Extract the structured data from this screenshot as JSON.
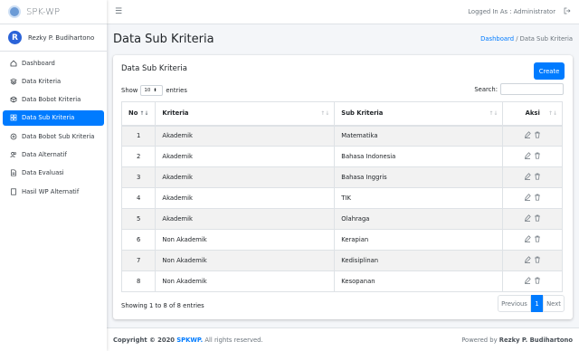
{
  "app": {
    "brand": "SPK-WP",
    "user_initial": "R",
    "user_name": "Rezky P. Budihartono"
  },
  "sidebar": {
    "items": [
      {
        "label": "Dashboard",
        "icon": "home-icon"
      },
      {
        "label": "Data Kriteria",
        "icon": "layers-icon"
      },
      {
        "label": "Data Bobot Kriteria",
        "icon": "cube-icon"
      },
      {
        "label": "Data Sub Kriteria",
        "icon": "grid-icon"
      },
      {
        "label": "Data Bobot Sub Kriteria",
        "icon": "circle-plus-icon"
      },
      {
        "label": "Data Alternatif",
        "icon": "users-icon"
      },
      {
        "label": "Data Evaluasi",
        "icon": "file-icon"
      },
      {
        "label": "Hasil WP Alternatif",
        "icon": "document-icon"
      }
    ],
    "active_index": 3
  },
  "navbar": {
    "logged_in": "Logged In As : Administrator"
  },
  "header": {
    "title": "Data Sub Kriteria",
    "crumb_link": "Dashboard",
    "crumb_sep": "/",
    "crumb_current": "Data Sub Kriteria"
  },
  "card": {
    "title": "Data Sub Kriteria",
    "create": "Create",
    "show": "Show",
    "entries_value": "10",
    "entries": "entries",
    "search": "Search:"
  },
  "table": {
    "headers": [
      "No",
      "Kriteria",
      "Sub Kriteria",
      "Aksi"
    ],
    "rows": [
      [
        "1",
        "Akademik",
        "Matematika"
      ],
      [
        "2",
        "Akademik",
        "Bahasa Indonesia"
      ],
      [
        "3",
        "Akademik",
        "Bahasa Inggris"
      ],
      [
        "4",
        "Akademik",
        "TIK"
      ],
      [
        "5",
        "Akademik",
        "Olahraga"
      ],
      [
        "6",
        "Non Akademik",
        "Kerapian"
      ],
      [
        "7",
        "Non Akademik",
        "Kedisiplinan"
      ],
      [
        "8",
        "Non Akademik",
        "Kesopanan"
      ]
    ]
  },
  "pagination": {
    "info": "Showing 1 to 8 of 8 entries",
    "previous": "Previous",
    "current": "1",
    "next": "Next"
  },
  "footer": {
    "copy": "Copyright © 2020",
    "brand": "SPKWP.",
    "rights": "All rights reserved.",
    "powered": "Powered by",
    "author": "Rezky P. Budihartono"
  },
  "colors": {
    "primary": "#007bff",
    "sidebar_bg": "#ffffff",
    "body_bg": "#f4f6f9"
  }
}
